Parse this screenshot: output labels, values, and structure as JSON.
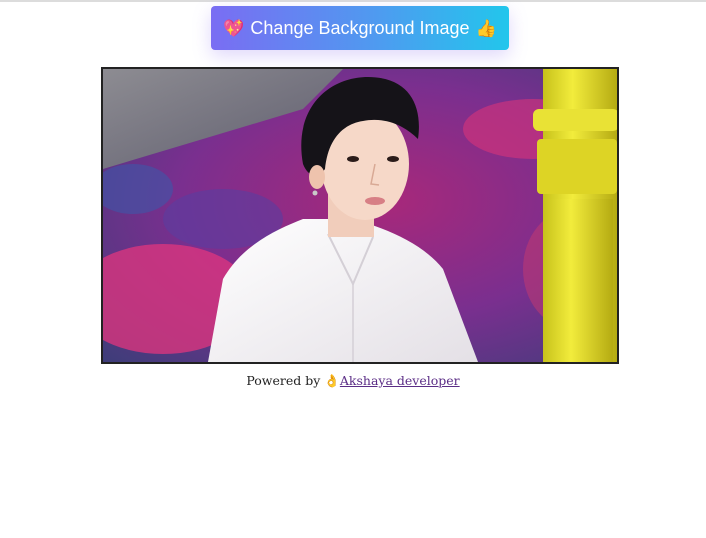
{
  "header": {
    "button_emoji_left": "💖",
    "button_label": "Change Background Image",
    "button_emoji_right": "👍"
  },
  "main": {
    "image_description_icon": "portrait-photo"
  },
  "footer": {
    "prefix": "Powered by",
    "emoji": "👌",
    "link_text": "Akshaya developer"
  },
  "colors": {
    "button_gradient_start": "#7a6df3",
    "button_gradient_end": "#22c6ec",
    "link": "#5b2d86"
  }
}
